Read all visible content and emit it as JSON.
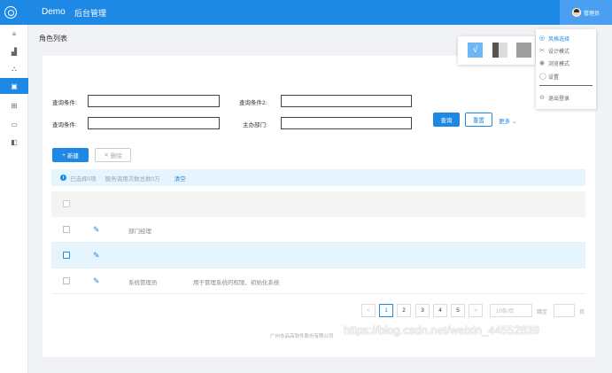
{
  "header": {
    "brand": "Demo",
    "app_title": "后台管理",
    "user_name": "管理员"
  },
  "sidebar": {
    "items": [
      {
        "icon": "menu-icon",
        "glyph": "≡",
        "active": false
      },
      {
        "icon": "chart-icon",
        "glyph": "▟",
        "active": false
      },
      {
        "icon": "network-icon",
        "glyph": "⛬",
        "active": false
      },
      {
        "icon": "image-icon",
        "glyph": "▣",
        "active": true
      },
      {
        "icon": "grid-icon",
        "glyph": "⊞",
        "active": false
      },
      {
        "icon": "monitor-icon",
        "glyph": "▭",
        "active": false
      },
      {
        "icon": "book-icon",
        "glyph": "◧",
        "active": false
      }
    ]
  },
  "page": {
    "title": "角色列表"
  },
  "filters": {
    "label_1": "查询条件:",
    "label_2": "查询条件2:",
    "label_3": "查询条件:",
    "label_4": "主办部门:",
    "value_1": "",
    "value_2": "",
    "value_3": "",
    "value_4": ""
  },
  "actions": {
    "search": "查询",
    "reset": "重置",
    "more": "更多",
    "more_icon": "chevron-down-icon",
    "new": "新建",
    "new_prefix": "+",
    "delete": "删除",
    "delete_prefix": "✕"
  },
  "alert": {
    "icon": "info-icon",
    "selected_text": "已选择0项",
    "stats_text": "服务调用次数总数0万",
    "clear": "清空"
  },
  "table": {
    "rows": [
      {
        "name": "部门经理",
        "desc": "",
        "selected": false
      },
      {
        "name": "",
        "desc": "",
        "selected": true
      },
      {
        "name": "系统管理员",
        "desc": "用于管理系统的权限、初始化系统",
        "selected": false
      }
    ]
  },
  "pagination": {
    "pages": [
      "1",
      "2",
      "3",
      "4",
      "5"
    ],
    "current": "1",
    "prev": "<",
    "next": ">",
    "page_size": "10条/页",
    "jump_label": "跳至",
    "page_unit": "页",
    "jump_value": ""
  },
  "theme_panel": {
    "check": "√"
  },
  "user_menu": {
    "items": [
      {
        "label": "风格选择",
        "icon": "palette-icon",
        "glyph": "◎",
        "active": true
      },
      {
        "label": "设计模式",
        "icon": "scissors-icon",
        "glyph": "✂",
        "active": false
      },
      {
        "label": "浏览模式",
        "icon": "eye-icon",
        "glyph": "◉",
        "active": false
      },
      {
        "label": "设置",
        "icon": "settings-icon",
        "glyph": "◯",
        "active": false
      },
      {
        "label": "退出登录",
        "icon": "logout-icon",
        "glyph": "⊖",
        "active": false
      }
    ]
  },
  "footer": {
    "copyright": "广州市品高软件股份有限公司",
    "watermark": "https://blog.csdn.net/weixin_44552839"
  },
  "colors": {
    "primary": "#1e88e5",
    "selected_row": "#e6f4fd"
  }
}
